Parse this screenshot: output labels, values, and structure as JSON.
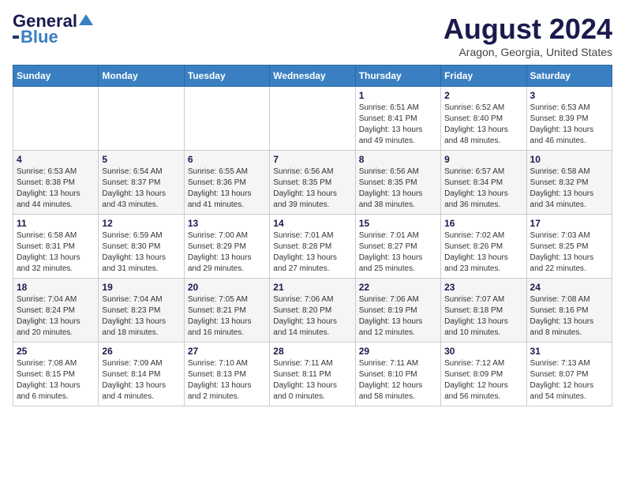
{
  "header": {
    "logo_line1": "General",
    "logo_line2": "Blue",
    "month_year": "August 2024",
    "location": "Aragon, Georgia, United States"
  },
  "days_of_week": [
    "Sunday",
    "Monday",
    "Tuesday",
    "Wednesday",
    "Thursday",
    "Friday",
    "Saturday"
  ],
  "weeks": [
    [
      {
        "day": "",
        "info": ""
      },
      {
        "day": "",
        "info": ""
      },
      {
        "day": "",
        "info": ""
      },
      {
        "day": "",
        "info": ""
      },
      {
        "day": "1",
        "info": "Sunrise: 6:51 AM\nSunset: 8:41 PM\nDaylight: 13 hours\nand 49 minutes."
      },
      {
        "day": "2",
        "info": "Sunrise: 6:52 AM\nSunset: 8:40 PM\nDaylight: 13 hours\nand 48 minutes."
      },
      {
        "day": "3",
        "info": "Sunrise: 6:53 AM\nSunset: 8:39 PM\nDaylight: 13 hours\nand 46 minutes."
      }
    ],
    [
      {
        "day": "4",
        "info": "Sunrise: 6:53 AM\nSunset: 8:38 PM\nDaylight: 13 hours\nand 44 minutes."
      },
      {
        "day": "5",
        "info": "Sunrise: 6:54 AM\nSunset: 8:37 PM\nDaylight: 13 hours\nand 43 minutes."
      },
      {
        "day": "6",
        "info": "Sunrise: 6:55 AM\nSunset: 8:36 PM\nDaylight: 13 hours\nand 41 minutes."
      },
      {
        "day": "7",
        "info": "Sunrise: 6:56 AM\nSunset: 8:35 PM\nDaylight: 13 hours\nand 39 minutes."
      },
      {
        "day": "8",
        "info": "Sunrise: 6:56 AM\nSunset: 8:35 PM\nDaylight: 13 hours\nand 38 minutes."
      },
      {
        "day": "9",
        "info": "Sunrise: 6:57 AM\nSunset: 8:34 PM\nDaylight: 13 hours\nand 36 minutes."
      },
      {
        "day": "10",
        "info": "Sunrise: 6:58 AM\nSunset: 8:32 PM\nDaylight: 13 hours\nand 34 minutes."
      }
    ],
    [
      {
        "day": "11",
        "info": "Sunrise: 6:58 AM\nSunset: 8:31 PM\nDaylight: 13 hours\nand 32 minutes."
      },
      {
        "day": "12",
        "info": "Sunrise: 6:59 AM\nSunset: 8:30 PM\nDaylight: 13 hours\nand 31 minutes."
      },
      {
        "day": "13",
        "info": "Sunrise: 7:00 AM\nSunset: 8:29 PM\nDaylight: 13 hours\nand 29 minutes."
      },
      {
        "day": "14",
        "info": "Sunrise: 7:01 AM\nSunset: 8:28 PM\nDaylight: 13 hours\nand 27 minutes."
      },
      {
        "day": "15",
        "info": "Sunrise: 7:01 AM\nSunset: 8:27 PM\nDaylight: 13 hours\nand 25 minutes."
      },
      {
        "day": "16",
        "info": "Sunrise: 7:02 AM\nSunset: 8:26 PM\nDaylight: 13 hours\nand 23 minutes."
      },
      {
        "day": "17",
        "info": "Sunrise: 7:03 AM\nSunset: 8:25 PM\nDaylight: 13 hours\nand 22 minutes."
      }
    ],
    [
      {
        "day": "18",
        "info": "Sunrise: 7:04 AM\nSunset: 8:24 PM\nDaylight: 13 hours\nand 20 minutes."
      },
      {
        "day": "19",
        "info": "Sunrise: 7:04 AM\nSunset: 8:23 PM\nDaylight: 13 hours\nand 18 minutes."
      },
      {
        "day": "20",
        "info": "Sunrise: 7:05 AM\nSunset: 8:21 PM\nDaylight: 13 hours\nand 16 minutes."
      },
      {
        "day": "21",
        "info": "Sunrise: 7:06 AM\nSunset: 8:20 PM\nDaylight: 13 hours\nand 14 minutes."
      },
      {
        "day": "22",
        "info": "Sunrise: 7:06 AM\nSunset: 8:19 PM\nDaylight: 13 hours\nand 12 minutes."
      },
      {
        "day": "23",
        "info": "Sunrise: 7:07 AM\nSunset: 8:18 PM\nDaylight: 13 hours\nand 10 minutes."
      },
      {
        "day": "24",
        "info": "Sunrise: 7:08 AM\nSunset: 8:16 PM\nDaylight: 13 hours\nand 8 minutes."
      }
    ],
    [
      {
        "day": "25",
        "info": "Sunrise: 7:08 AM\nSunset: 8:15 PM\nDaylight: 13 hours\nand 6 minutes."
      },
      {
        "day": "26",
        "info": "Sunrise: 7:09 AM\nSunset: 8:14 PM\nDaylight: 13 hours\nand 4 minutes."
      },
      {
        "day": "27",
        "info": "Sunrise: 7:10 AM\nSunset: 8:13 PM\nDaylight: 13 hours\nand 2 minutes."
      },
      {
        "day": "28",
        "info": "Sunrise: 7:11 AM\nSunset: 8:11 PM\nDaylight: 13 hours\nand 0 minutes."
      },
      {
        "day": "29",
        "info": "Sunrise: 7:11 AM\nSunset: 8:10 PM\nDaylight: 12 hours\nand 58 minutes."
      },
      {
        "day": "30",
        "info": "Sunrise: 7:12 AM\nSunset: 8:09 PM\nDaylight: 12 hours\nand 56 minutes."
      },
      {
        "day": "31",
        "info": "Sunrise: 7:13 AM\nSunset: 8:07 PM\nDaylight: 12 hours\nand 54 minutes."
      }
    ]
  ]
}
